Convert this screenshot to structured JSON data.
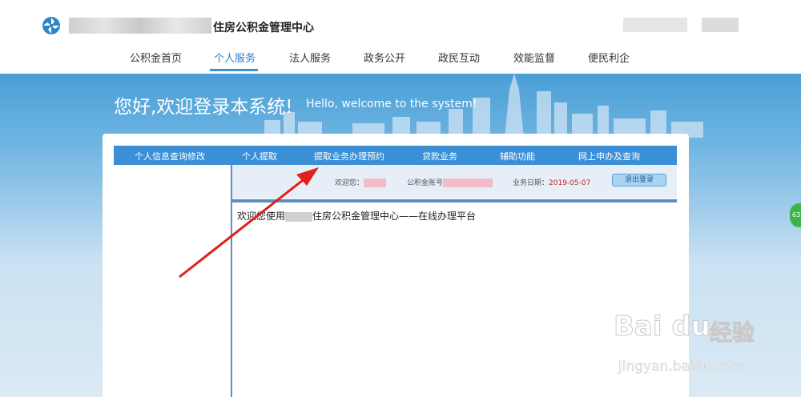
{
  "header": {
    "site_title": "住房公积金管理中心",
    "nav": [
      "公积金首页",
      "个人服务",
      "法人服务",
      "政务公开",
      "政民互动",
      "效能监督",
      "便民利企"
    ],
    "active_nav": "个人服务"
  },
  "hero": {
    "welcome_cn": "您好,欢迎登录本系统!",
    "welcome_en": "Hello, welcome to the system!"
  },
  "menu": {
    "items": [
      "个人信息查询修改",
      "个人提取",
      "提取业务办理预约",
      "贷款业务",
      "辅助功能",
      "网上申办及查询"
    ]
  },
  "userbar": {
    "welcome_label": "欢迎您：",
    "account_label": "公积金账号",
    "date_label": "业务日期：",
    "date_value": "2019-05-07",
    "logout": "退出登录"
  },
  "content": {
    "prefix": "欢迎您使用",
    "suffix": "住房公积金管理中心——在线办理平台"
  },
  "side_badge": "63",
  "watermark": {
    "brand": "Bai du",
    "cn": "经验",
    "url": "jingyan.baidu.com"
  },
  "colors": {
    "accent": "#3b8fd6",
    "arrow": "#e0201b"
  }
}
